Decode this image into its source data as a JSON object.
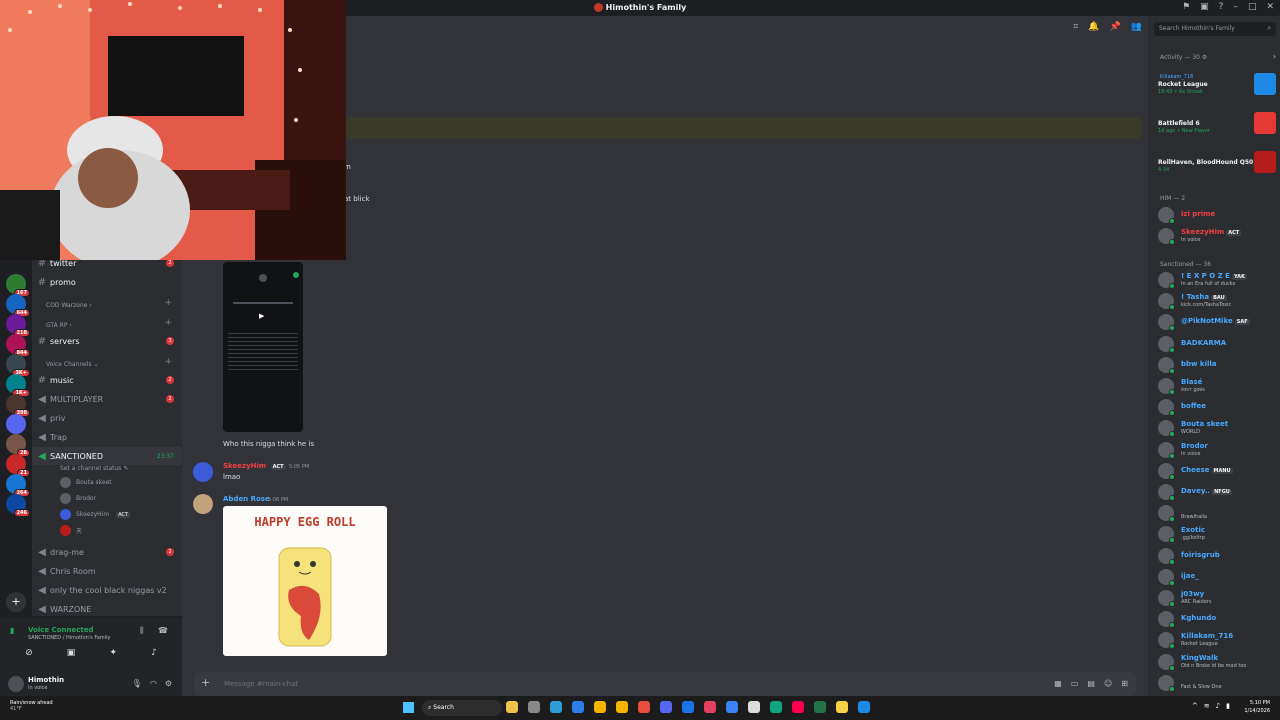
{
  "window": {
    "title": "Himothin's Family"
  },
  "servers": [
    {
      "badge": "167",
      "color": "#2e7d32"
    },
    {
      "badge": "644",
      "color": "#1565c0"
    },
    {
      "badge": "218",
      "color": "#6a1b9a"
    },
    {
      "badge": "844",
      "color": "#ad1457"
    },
    {
      "badge": "3K+",
      "color": "#37474f"
    },
    {
      "badge": "1K+",
      "color": "#00838f"
    },
    {
      "badge": "398",
      "color": "#4e342e"
    },
    {
      "badge": "",
      "color": "#5865f2"
    },
    {
      "badge": "26",
      "color": "#795548"
    },
    {
      "badge": "21",
      "color": "#c62828"
    },
    {
      "badge": "264",
      "color": "#1976d2"
    },
    {
      "badge": "246",
      "color": "#0d47a1"
    }
  ],
  "channels": {
    "items": [
      {
        "type": "text",
        "name": "twitter",
        "unread": "2"
      },
      {
        "type": "text",
        "name": "promo",
        "unread": ""
      }
    ],
    "cat_warzone": "COD Warzone ›",
    "cat_gtarp": "GTA RP ›",
    "servers_channel": {
      "name": "servers",
      "unread": "3"
    },
    "cat_voice": "Voice Channels ⌄",
    "music": {
      "name": "music",
      "unread": "2"
    },
    "multiplayer": {
      "name": "MULTIPLAYER",
      "unread": "2"
    },
    "priv": "priv",
    "trap": "Trap",
    "sanctioned": {
      "name": "SANCTIONED",
      "timer": "23:37",
      "status": "Set a channel status ✎"
    },
    "voice_users": [
      {
        "name": "Bouta skeet"
      },
      {
        "name": "Brodor"
      },
      {
        "name": "SkeezyHim",
        "tag": "ACT"
      },
      {
        "name": "天"
      }
    ],
    "dragme": {
      "name": "drag-me",
      "unread": "2"
    },
    "chris_room": "Chris Room",
    "cool": "only the cool black niggas v2",
    "warzone": "WARZONE"
  },
  "voice_panel": {
    "status": "Voice Connected",
    "sub": "SANCTIONED / Himothin's Family"
  },
  "user_panel": {
    "name": "Himothin",
    "status": "In voice"
  },
  "chat": {
    "partial_1": "m",
    "partial_2": "at blick",
    "msg_caption": "Who this nigga think he is",
    "messages": [
      {
        "author": "SkeezyHim",
        "tag": "ACT",
        "time": "5:05 PM",
        "text": "lmao",
        "color": "#f23f43"
      },
      {
        "author": "Abden Rose",
        "time": "5:06 PM",
        "color": "#4aa8ff"
      }
    ],
    "gif_title": "HAPPY EGG ROLL",
    "composer_placeholder": "Message #main-chat"
  },
  "members": {
    "search_placeholder": "Search Himothin's Family",
    "activity_header": "Activity — 30 ⚙",
    "activities": [
      {
        "user": "Killakam_716",
        "game": "Rocket League",
        "meta": "19:43 ⚡ 6x Streak",
        "color": "#1e88e5"
      },
      {
        "user": "",
        "game": "Battlefield 6",
        "meta": "1d ago  ⚡ New Player",
        "color": "#e53935"
      },
      {
        "user": "",
        "game": "RellHaven, BloodHound Q50",
        "meta": "4:34",
        "color": "#b71c1c"
      }
    ],
    "him_header": "HIM — 2",
    "him": [
      {
        "name": "izi prime",
        "sub": "",
        "color": "#f23f43"
      },
      {
        "name": "SkeezyHim",
        "tag": "ACT",
        "sub": "In voice",
        "color": "#f23f43"
      }
    ],
    "sanctioned_header": "Sanctioned — 36",
    "sanctioned": [
      {
        "name": "! E X P O Z E",
        "tag": "YAK",
        "sub": "In an Era full of ducks",
        "color": "#4aa8ff"
      },
      {
        "name": "! Tasha",
        "tag": "BAU",
        "sub": "kick.com/TashaToxic",
        "color": "#4aa8ff"
      },
      {
        "name": "@PikNotMike",
        "tag": "SAF",
        "sub": "",
        "color": "#4aa8ff"
      },
      {
        "name": "BADKARMA",
        "sub": "",
        "color": "#4aa8ff"
      },
      {
        "name": "bbw killa",
        "sub": "",
        "color": "#4aa8ff"
      },
      {
        "name": "Blasé",
        "sub": "ℓσѕт gσ∂ѕ",
        "color": "#4aa8ff"
      },
      {
        "name": "boffee",
        "sub": "",
        "color": "#4aa8ff"
      },
      {
        "name": "Bouta skeet",
        "sub": "WORLD",
        "color": "#4aa8ff"
      },
      {
        "name": "Brodor",
        "sub": "In voice",
        "color": "#4aa8ff"
      },
      {
        "name": "Cheese",
        "tag": "MANU",
        "sub": "",
        "color": "#4aa8ff"
      },
      {
        "name": "Davey..",
        "tag": "NFGU",
        "sub": "",
        "color": "#4aa8ff"
      },
      {
        "name": "",
        "sub": "Brawlhalla",
        "color": "#f23f43"
      },
      {
        "name": "Exotic",
        "sub": ".gg/koltrp",
        "color": "#4aa8ff"
      },
      {
        "name": "foirisgrub",
        "sub": "",
        "color": "#4aa8ff"
      },
      {
        "name": "ijae_",
        "sub": "",
        "color": "#4aa8ff"
      },
      {
        "name": "j03wy",
        "sub": "ARC Raiders",
        "color": "#4aa8ff"
      },
      {
        "name": "Kghundo",
        "sub": "",
        "color": "#4aa8ff"
      },
      {
        "name": "Killakam_716",
        "sub": "Rocket League",
        "color": "#4aa8ff"
      },
      {
        "name": "KingWalk",
        "sub": "Old n Broke id be mad too",
        "color": "#4aa8ff"
      },
      {
        "name": "",
        "sub": "Fast & Slow One",
        "color": "#f23f43"
      }
    ]
  },
  "taskbar": {
    "weather": "Rain/snow ahead",
    "weather_sub": "41°F",
    "search": "Search",
    "time": "5:10 PM",
    "date": "1/14/2026"
  }
}
